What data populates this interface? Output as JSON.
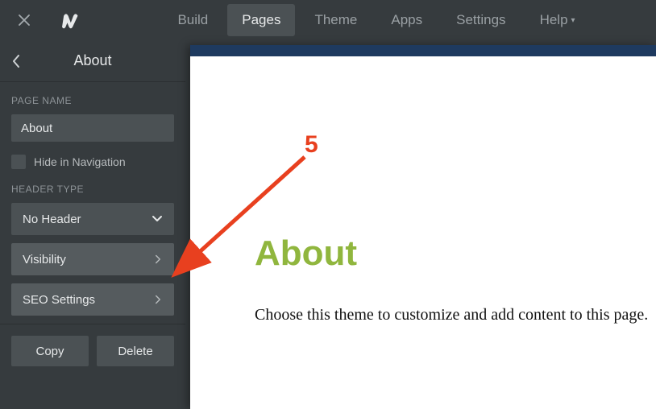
{
  "topnav": {
    "items": [
      {
        "label": "Build"
      },
      {
        "label": "Pages"
      },
      {
        "label": "Theme"
      },
      {
        "label": "Apps"
      },
      {
        "label": "Settings"
      },
      {
        "label": "Help"
      }
    ]
  },
  "sidebar": {
    "title": "About",
    "page_name_label": "PAGE NAME",
    "page_name_value": "About",
    "hide_nav_label": "Hide in Navigation",
    "header_type_label": "HEADER TYPE",
    "header_type_value": "No Header",
    "visibility_label": "Visibility",
    "seo_label": "SEO Settings",
    "copy_label": "Copy",
    "delete_label": "Delete"
  },
  "page": {
    "heading": "About",
    "body": "Choose this theme to customize and add content to this page."
  },
  "annotation": {
    "number": "5"
  }
}
